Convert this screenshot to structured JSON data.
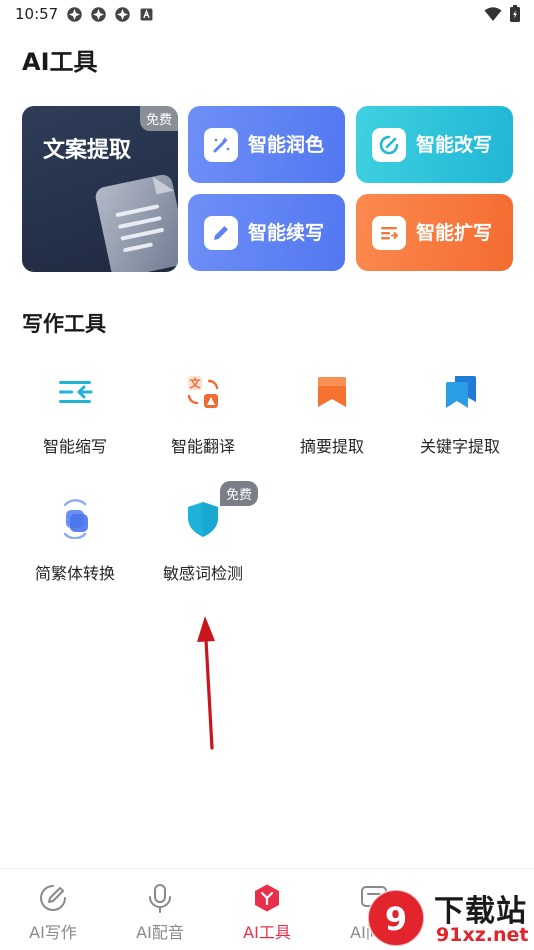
{
  "status_bar": {
    "time": "10:57"
  },
  "page": {
    "title": "AI工具"
  },
  "featured": {
    "main_card": {
      "label": "文案提取",
      "badge": "免费"
    },
    "cards": {
      "polish": "智能润色",
      "rewrite": "智能改写",
      "continue": "智能续写",
      "expand": "智能扩写"
    }
  },
  "writing_tools": {
    "title": "写作工具",
    "items": [
      {
        "label": "智能缩写"
      },
      {
        "label": "智能翻译"
      },
      {
        "label": "摘要提取"
      },
      {
        "label": "关键字提取"
      },
      {
        "label": "简繁体转换"
      },
      {
        "label": "敏感词检测",
        "badge": "免费"
      }
    ]
  },
  "bottom_nav": {
    "items": [
      {
        "label": "AI写作"
      },
      {
        "label": "AI配音"
      },
      {
        "label": "AI工具"
      },
      {
        "label": "AI问答"
      }
    ],
    "active": "AI工具"
  },
  "watermark": {
    "top": "下载站",
    "bottom": "91xz.net"
  },
  "colors": {
    "accent": "#e8304a",
    "polish": "#5f83f4",
    "rewrite": "#2bc2da",
    "expand": "#f6773c",
    "main_card": "#28344c"
  }
}
